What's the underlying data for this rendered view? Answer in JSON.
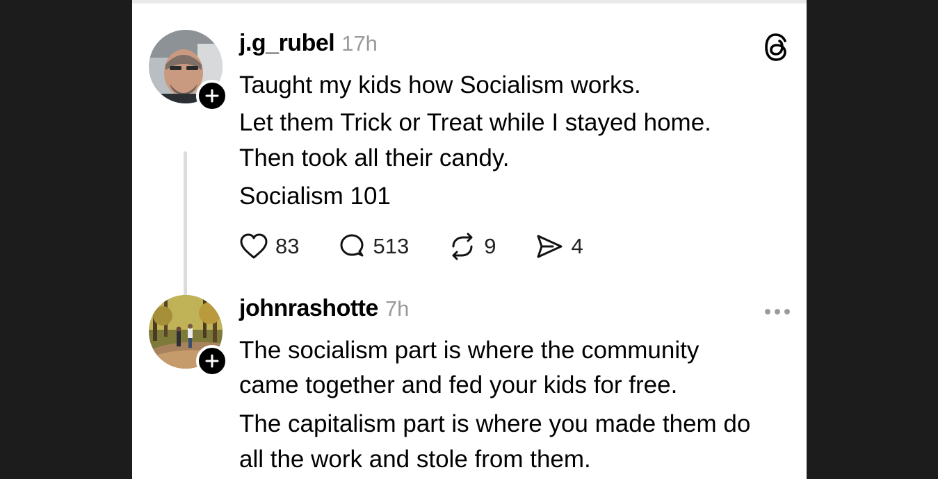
{
  "posts": [
    {
      "username": "j.g_rubel",
      "time": "17h",
      "avatar_icon": "man-portrait-avatar",
      "follow_icon": "plus-icon",
      "corner_icon": "threads-logo-icon",
      "lines": [
        "Taught my kids how Socialism works.",
        "Let them Trick or Treat while I stayed home.",
        "Then took all their candy.",
        "Socialism 101"
      ],
      "actions": [
        {
          "icon": "heart-icon",
          "count": "83"
        },
        {
          "icon": "comment-icon",
          "count": "513"
        },
        {
          "icon": "repost-icon",
          "count": "9"
        },
        {
          "icon": "share-icon",
          "count": "4"
        }
      ]
    },
    {
      "username": "johnrashotte",
      "time": "7h",
      "avatar_icon": "couple-walking-path-avatar",
      "follow_icon": "plus-icon",
      "corner_icon": "more-options-icon",
      "lines": [
        "The socialism part is where the community",
        "came together and fed your kids for free.",
        "The capitalism part is where you made them do",
        "all the work and stole from them."
      ]
    }
  ],
  "colors": {
    "background": "#1c1c1c",
    "card": "#ffffff",
    "timestamp": "#9a9a9a",
    "thread_line": "#dcdcdc"
  }
}
